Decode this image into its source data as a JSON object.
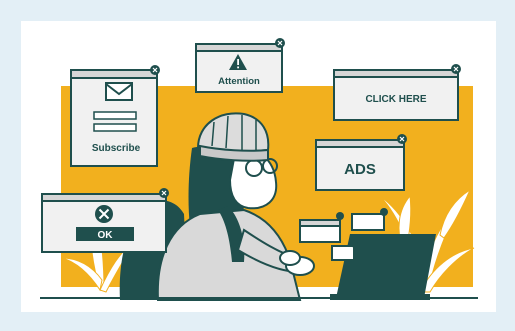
{
  "popups": {
    "subscribe": {
      "label": "Subscribe"
    },
    "attention": {
      "label": "Attention"
    },
    "click_here": {
      "label": "CLICK HERE"
    },
    "ads": {
      "label": "ADS"
    },
    "ok": {
      "label": "OK"
    }
  },
  "colors": {
    "background": "#e3eff6",
    "card": "#ffffff",
    "accent": "#f2b01e",
    "ink": "#1f4f4d",
    "popup_fill": "#f1f1f1",
    "popup_header": "#d6d6d6"
  },
  "icons": [
    "envelope-icon",
    "warning-icon",
    "close-icon",
    "laptop-icon",
    "leaf-icon"
  ]
}
